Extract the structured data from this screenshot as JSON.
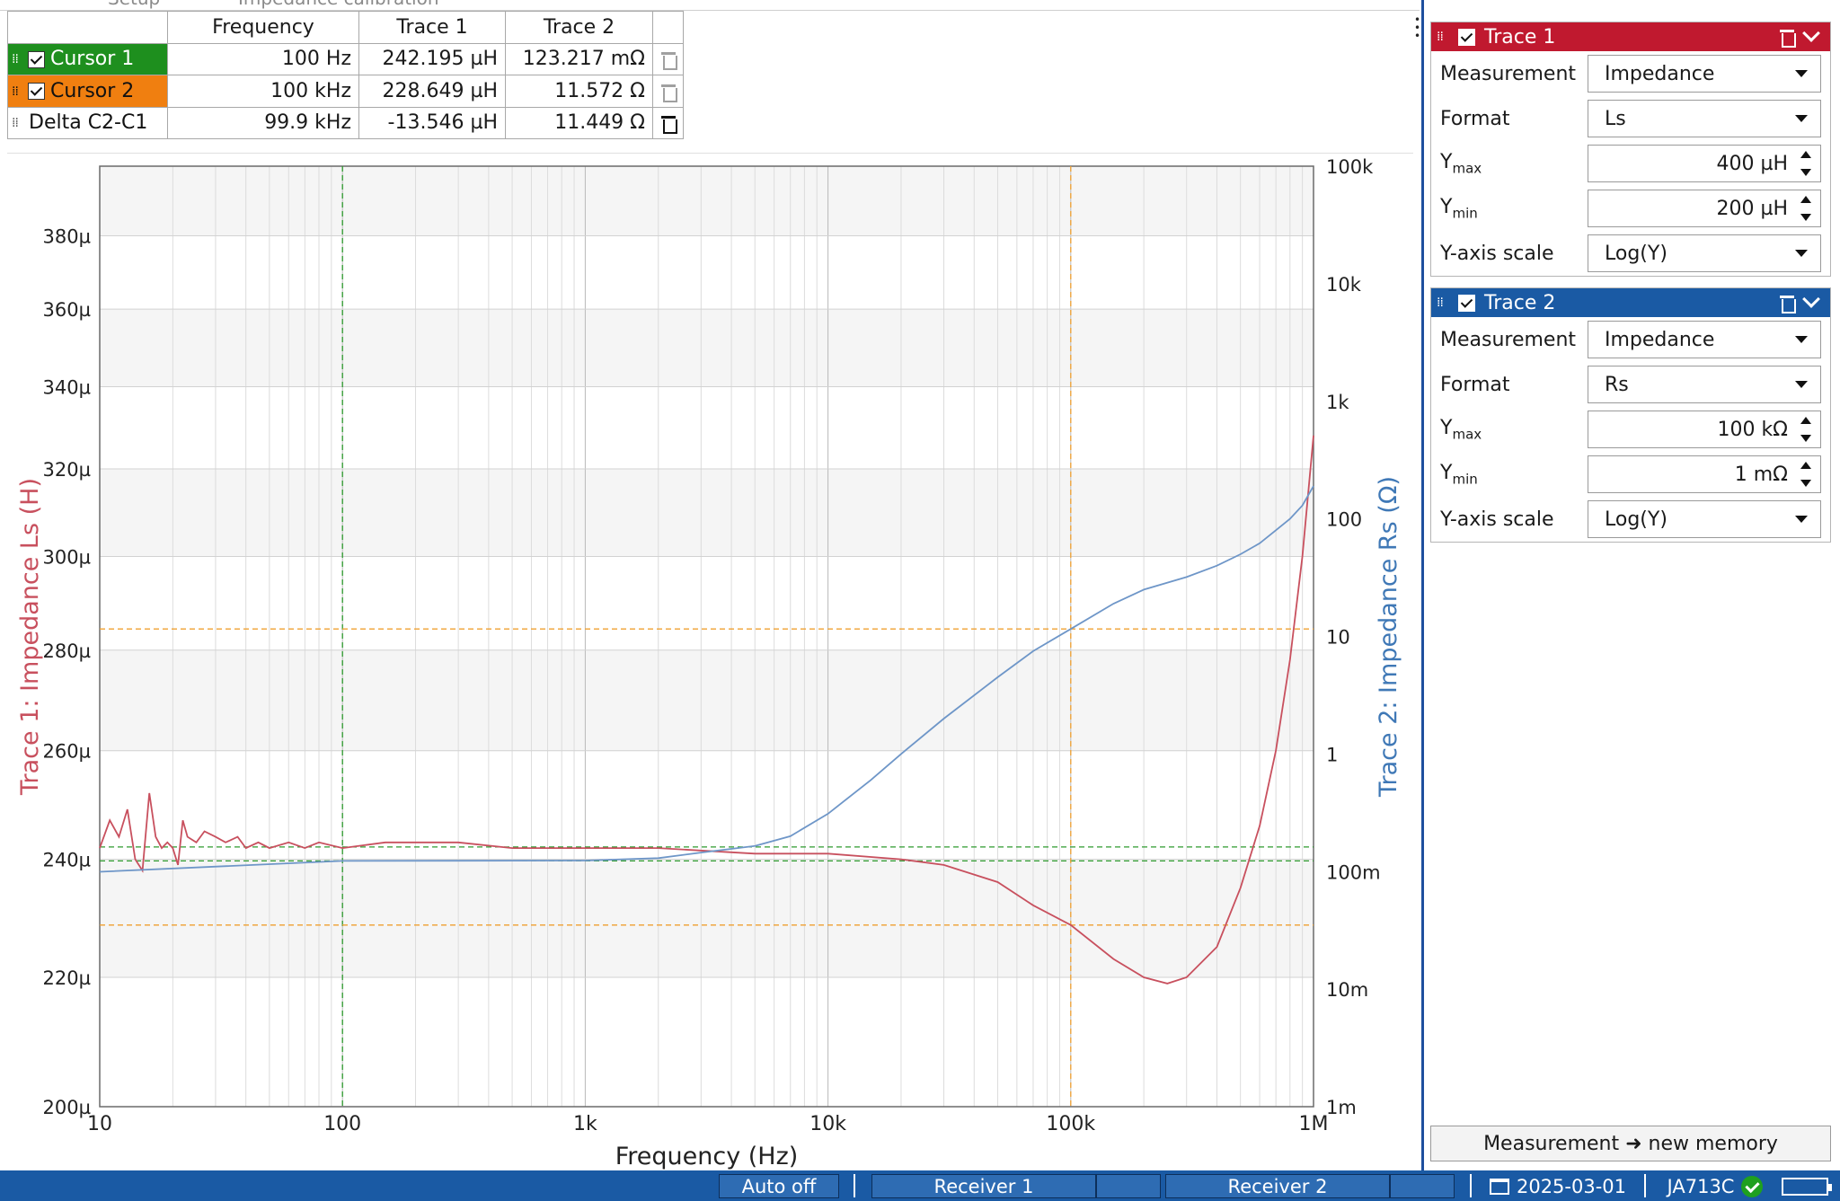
{
  "tabs": [
    "Setup",
    "Impedance calibration"
  ],
  "cursor_table": {
    "headers": [
      "Frequency",
      "Trace 1",
      "Trace 2"
    ],
    "rows": [
      {
        "name": "Cursor 1",
        "frequency": "100 Hz",
        "trace1": "242.195 µH",
        "trace2": "123.217 mΩ",
        "color": "#1e8f1e"
      },
      {
        "name": "Cursor 2",
        "frequency": "100 kHz",
        "trace1": "228.649 µH",
        "trace2": "11.572 Ω",
        "color": "#f07f10"
      },
      {
        "name": "Delta C2-C1",
        "frequency": "99.9 kHz",
        "trace1": "-13.546 µH",
        "trace2": "11.449 Ω"
      }
    ]
  },
  "chart_data": {
    "type": "line",
    "xlabel": "Frequency (Hz)",
    "ylabel_left": "Trace 1: Impedance Ls (H)",
    "ylabel_right": "Trace 2: Impedance Rs (Ω)",
    "x_scale": "log",
    "xlim": [
      10,
      1000000
    ],
    "x_ticks": [
      "10",
      "100",
      "1k",
      "10k",
      "100k",
      "1M"
    ],
    "y_left_scale": "log",
    "y_left_lim": [
      0.0002,
      0.0004
    ],
    "y_left_ticks": [
      "200µ",
      "220µ",
      "240µ",
      "260µ",
      "280µ",
      "300µ",
      "320µ",
      "340µ",
      "360µ",
      "380µ"
    ],
    "y_right_scale": "log",
    "y_right_lim": [
      0.001,
      100000
    ],
    "y_right_ticks": [
      "1m",
      "10m",
      "100m",
      "1",
      "10",
      "100",
      "1k",
      "10k",
      "100k"
    ],
    "grid": true,
    "cursors": [
      {
        "name": "Cursor 1",
        "x": 100,
        "trace1": 0.000242195,
        "trace2": 0.123217,
        "color": "#2e9a2e"
      },
      {
        "name": "Cursor 2",
        "x": 100000,
        "trace1": 0.000228649,
        "trace2": 11.572,
        "color": "#f0a030"
      }
    ],
    "series": [
      {
        "name": "Trace 1",
        "axis": "left",
        "color": "#c8505e",
        "points": [
          [
            10,
            0.000242
          ],
          [
            11,
            0.000247
          ],
          [
            12,
            0.000244
          ],
          [
            13,
            0.000249
          ],
          [
            14,
            0.00024
          ],
          [
            15,
            0.000238
          ],
          [
            16,
            0.000252
          ],
          [
            17,
            0.000244
          ],
          [
            18,
            0.000242
          ],
          [
            19,
            0.000243
          ],
          [
            20,
            0.000242
          ],
          [
            21,
            0.000239
          ],
          [
            22,
            0.000247
          ],
          [
            23,
            0.000244
          ],
          [
            25,
            0.000243
          ],
          [
            27,
            0.000245
          ],
          [
            30,
            0.000244
          ],
          [
            33,
            0.000243
          ],
          [
            37,
            0.000244
          ],
          [
            40,
            0.000242
          ],
          [
            45,
            0.000243
          ],
          [
            50,
            0.000242
          ],
          [
            60,
            0.000243
          ],
          [
            70,
            0.000242
          ],
          [
            80,
            0.000243
          ],
          [
            100,
            0.000242
          ],
          [
            150,
            0.000243
          ],
          [
            200,
            0.000243
          ],
          [
            300,
            0.000243
          ],
          [
            500,
            0.000242
          ],
          [
            1000,
            0.000242
          ],
          [
            2000,
            0.000242
          ],
          [
            5000,
            0.000241
          ],
          [
            10000,
            0.000241
          ],
          [
            20000,
            0.00024
          ],
          [
            30000,
            0.000239
          ],
          [
            50000,
            0.000236
          ],
          [
            70000,
            0.000232
          ],
          [
            100000,
            0.000228649
          ],
          [
            150000,
            0.000223
          ],
          [
            200000,
            0.00022
          ],
          [
            250000,
            0.000219
          ],
          [
            300000,
            0.00022
          ],
          [
            400000,
            0.000225
          ],
          [
            500000,
            0.000235
          ],
          [
            600000,
            0.000246
          ],
          [
            700000,
            0.00026
          ],
          [
            800000,
            0.000278
          ],
          [
            900000,
            0.0003
          ],
          [
            1000000,
            0.000328
          ]
        ]
      },
      {
        "name": "Trace 2",
        "axis": "right",
        "color": "#6e96c8",
        "points": [
          [
            10,
            0.0996
          ],
          [
            100,
            0.123217
          ],
          [
            1000,
            0.124
          ],
          [
            2000,
            0.13
          ],
          [
            3000,
            0.145
          ],
          [
            5000,
            0.165
          ],
          [
            7000,
            0.2
          ],
          [
            10000,
            0.31
          ],
          [
            15000,
            0.6
          ],
          [
            20000,
            1.0
          ],
          [
            30000,
            2.0
          ],
          [
            50000,
            4.5
          ],
          [
            70000,
            7.5
          ],
          [
            100000,
            11.572
          ],
          [
            150000,
            19
          ],
          [
            200000,
            25
          ],
          [
            300000,
            32
          ],
          [
            400000,
            40
          ],
          [
            500000,
            50
          ],
          [
            600000,
            62
          ],
          [
            700000,
            80
          ],
          [
            800000,
            100
          ],
          [
            900000,
            130
          ],
          [
            1000000,
            190
          ]
        ]
      }
    ]
  },
  "right_panel": {
    "trace1": {
      "title": "Trace 1",
      "color": "#c0192f",
      "measurement_label": "Measurement",
      "measurement": "Impedance",
      "format_label": "Format",
      "format": "Ls",
      "ymax_label": "Y",
      "ymax_sub": "max",
      "ymax": "400 µH",
      "ymin_label": "Y",
      "ymin_sub": "min",
      "ymin": "200 µH",
      "yscale_label": "Y-axis scale",
      "yscale": "Log(Y)"
    },
    "trace2": {
      "title": "Trace 2",
      "color": "#1a5aa4",
      "measurement_label": "Measurement",
      "measurement": "Impedance",
      "format_label": "Format",
      "format": "Rs",
      "ymax_label": "Y",
      "ymax_sub": "max",
      "ymax": "100 kΩ",
      "ymin_label": "Y",
      "ymin_sub": "min",
      "ymin": "1 mΩ",
      "yscale_label": "Y-axis scale",
      "yscale": "Log(Y)"
    },
    "memory_button": "Measurement ➜ new memory"
  },
  "statusbar": {
    "auto": "Auto off",
    "receiver1": "Receiver 1",
    "receiver2": "Receiver 2",
    "date": "2025-03-01",
    "device": "JA713C",
    "color": "#1a5aa4"
  }
}
